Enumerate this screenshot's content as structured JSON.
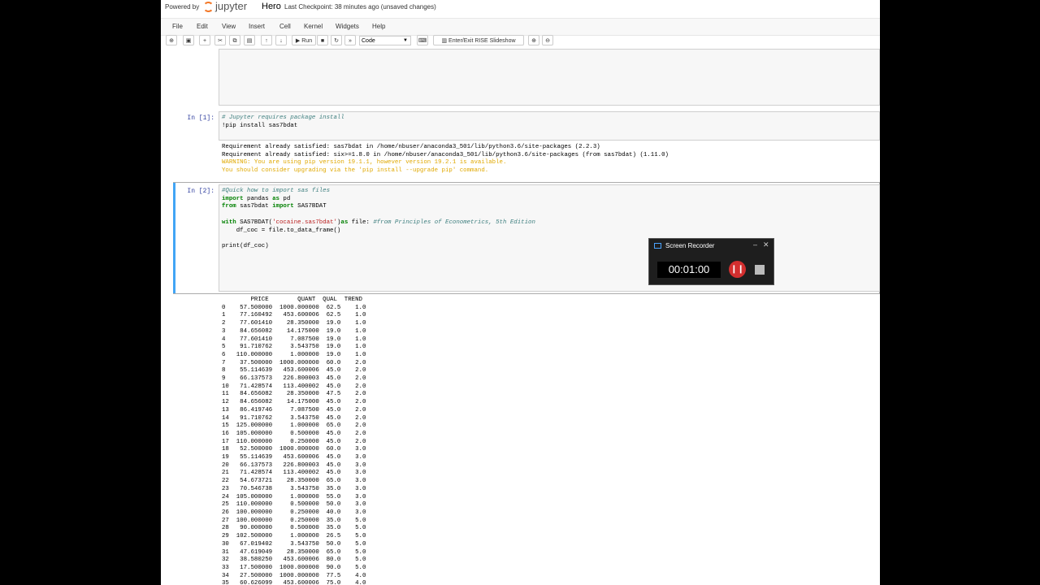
{
  "header": {
    "powered_by": "Powered by",
    "logo_text": "jupyter",
    "notebook_name": "Hero",
    "checkpoint": "Last Checkpoint: 38 minutes ago  (unsaved changes)"
  },
  "menu": [
    "File",
    "Edit",
    "View",
    "Insert",
    "Cell",
    "Kernel",
    "Widgets",
    "Help"
  ],
  "toolbar": {
    "run_label": "Run",
    "cell_type": "Code",
    "rise_label": "Enter/Exit RISE Slideshow"
  },
  "cells": [
    {
      "prompt": "In [1]:",
      "input": [
        "# Jupyter requires package install",
        "!pip install sas7bdat"
      ],
      "output": [
        "Requirement already satisfied: sas7bdat in /home/nbuser/anaconda3_501/lib/python3.6/site-packages (2.2.3)",
        "Requirement already satisfied: six>=1.8.0 in /home/nbuser/anaconda3_501/lib/python3.6/site-packages (from sas7bdat) (1.11.0)"
      ],
      "warnings": [
        "WARNING: You are using pip version 19.1.1, however version 19.2.1 is available.",
        "You should consider upgrading via the 'pip install --upgrade pip' command."
      ]
    },
    {
      "prompt": "In [2]:",
      "input": [
        "#Quick how to import sas files",
        "import pandas as pd",
        "from sas7bdat import SAS7BDAT",
        "",
        "with SAS7BDAT('cocaine.sas7bdat')as file: #from Principles of Econometrics, 5th Edition",
        "    df_coc = file.to_data_frame()",
        "",
        "print(df_coc)"
      ],
      "table_header": "        PRICE        QUANT  QUAL  TREND",
      "table_rows": [
        "0    57.500000  1000.000000  62.5    1.0",
        "1    77.160492   453.600006  62.5    1.0",
        "2    77.601410    28.350000  19.0    1.0",
        "3    84.656082    14.175000  19.0    1.0",
        "4    77.601410     7.087500  19.0    1.0",
        "5    91.710762     3.543750  19.0    1.0",
        "6   110.000000     1.000000  19.0    1.0",
        "7    37.500000  1000.000000  60.0    2.0",
        "8    55.114639   453.600006  45.0    2.0",
        "9    66.137573   226.800003  45.0    2.0",
        "10   71.428574   113.400002  45.0    2.0",
        "11   84.656082    28.350000  47.5    2.0",
        "12   84.656082    14.175000  45.0    2.0",
        "13   86.419746     7.087500  45.0    2.0",
        "14   91.710762     3.543750  45.0    2.0",
        "15  125.000000     1.000000  65.0    2.0",
        "16  105.000000     0.500000  45.0    2.0",
        "17  110.000000     0.250000  45.0    2.0",
        "18   52.500000  1000.000000  60.0    3.0",
        "19   55.114639   453.600006  45.0    3.0",
        "20   66.137573   226.800003  45.0    3.0",
        "21   71.428574   113.400002  45.0    3.0",
        "22   54.673721    28.350000  65.0    3.0",
        "23   70.546738     3.543750  35.0    3.0",
        "24  105.000000     1.000000  55.0    3.0",
        "25  110.000000     0.500000  50.0    3.0",
        "26  100.000000     0.250000  40.0    3.0",
        "27  100.000000     0.250000  35.0    5.0",
        "28   90.000000     0.500000  35.0    5.0",
        "29  102.500000     1.000000  26.5    5.0",
        "30   67.019402     3.543750  50.0    5.0",
        "31   47.619049    28.350000  65.0    5.0",
        "32   38.580250   453.600006  80.0    5.0",
        "33   17.500000  1000.000000  90.0    5.0",
        "34   27.500000  1000.000000  77.5    4.0",
        "35   60.626099   453.600006  75.0    4.0"
      ]
    }
  ],
  "recorder": {
    "title": "Screen Recorder",
    "time": "00:01:00"
  }
}
